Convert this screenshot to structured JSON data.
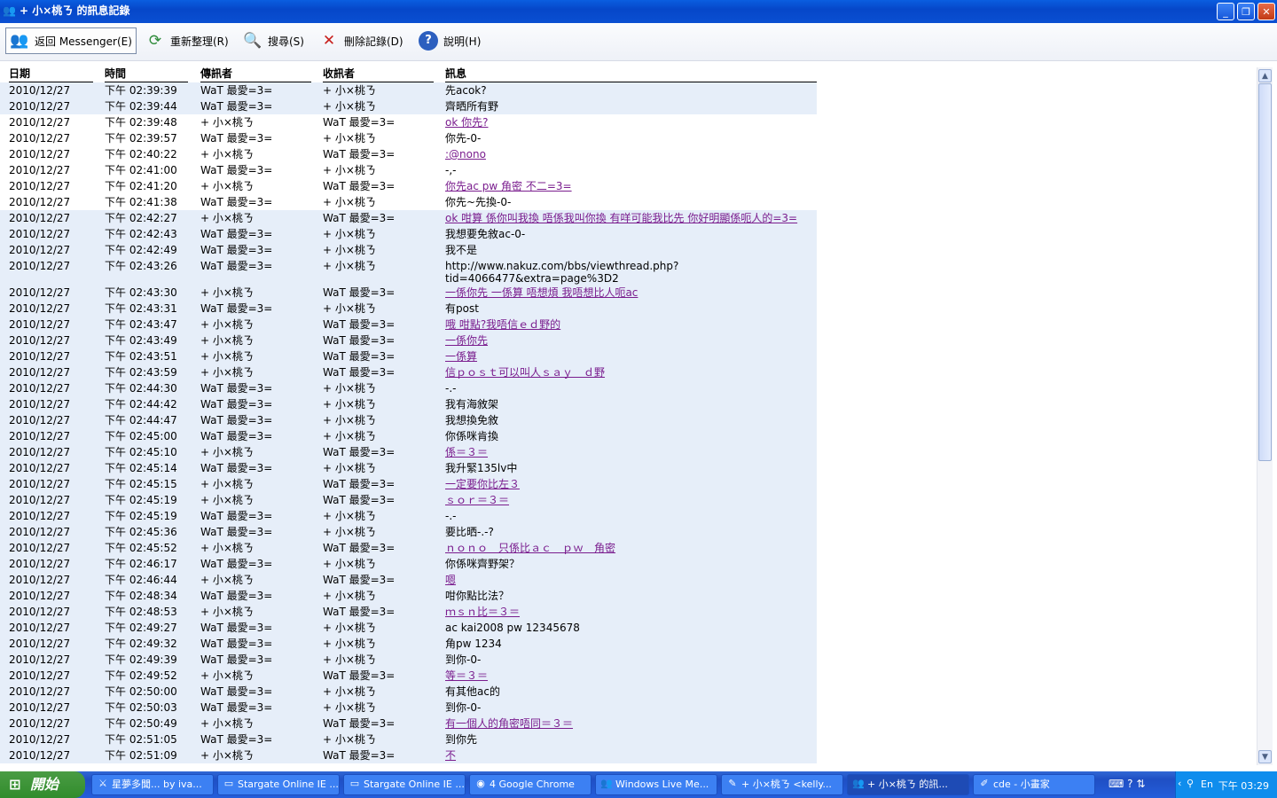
{
  "window": {
    "title": "+ 小×桃ㄋ 的訊息記錄",
    "icon": "messenger-people-icon",
    "minimize": "_",
    "restore": "❐",
    "close": "✕"
  },
  "toolbar": {
    "back_label": "返回 Messenger(E)",
    "refresh_label": "重新整理(R)",
    "search_label": "搜尋(S)",
    "delete_label": "刪除記錄(D)",
    "help_label": "說明(H)"
  },
  "table": {
    "headers": {
      "date": "日期",
      "time": "時間",
      "from": "傳訊者",
      "to": "收訊者",
      "msg": "訊息"
    },
    "rows": [
      {
        "date": "2010/12/27",
        "time": "下午 02:39:39",
        "from": "WaT 最愛=3=",
        "to": "+ 小×桃ㄋ",
        "msg": "先acok?",
        "link": false
      },
      {
        "date": "2010/12/27",
        "time": "下午 02:39:44",
        "from": "WaT 最愛=3=",
        "to": "+ 小×桃ㄋ",
        "msg": "齊晒所有野",
        "link": false
      },
      {
        "date": "2010/12/27",
        "time": "下午 02:39:48",
        "from": "+ 小×桃ㄋ",
        "to": "WaT 最愛=3=",
        "msg": "ok 你先?",
        "link": true
      },
      {
        "date": "2010/12/27",
        "time": "下午 02:39:57",
        "from": "WaT 最愛=3=",
        "to": "+ 小×桃ㄋ",
        "msg": "你先-0-",
        "link": false
      },
      {
        "date": "2010/12/27",
        "time": "下午 02:40:22",
        "from": "+ 小×桃ㄋ",
        "to": "WaT 最愛=3=",
        "msg": ":@nono",
        "link": true
      },
      {
        "date": "2010/12/27",
        "time": "下午 02:41:00",
        "from": "WaT 最愛=3=",
        "to": "+ 小×桃ㄋ",
        "msg": "-,-",
        "link": false
      },
      {
        "date": "2010/12/27",
        "time": "下午 02:41:20",
        "from": "+ 小×桃ㄋ",
        "to": "WaT 最愛=3=",
        "msg": "你先ac pw 角密 不二=3=",
        "link": true
      },
      {
        "date": "2010/12/27",
        "time": "下午 02:41:38",
        "from": "WaT 最愛=3=",
        "to": "+ 小×桃ㄋ",
        "msg": "你先~先換-0-",
        "link": false
      },
      {
        "date": "2010/12/27",
        "time": "下午 02:42:27",
        "from": "+ 小×桃ㄋ",
        "to": "WaT 最愛=3=",
        "msg": "ok 咁算 係你叫我換 唔係我叫你換 有咩可能我比先 你好明顯係呃人的=3=",
        "link": true
      },
      {
        "date": "2010/12/27",
        "time": "下午 02:42:43",
        "from": "WaT 最愛=3=",
        "to": "+ 小×桃ㄋ",
        "msg": "我想要免敘ac-0-",
        "link": false
      },
      {
        "date": "2010/12/27",
        "time": "下午 02:42:49",
        "from": "WaT 最愛=3=",
        "to": "+ 小×桃ㄋ",
        "msg": "我不是",
        "link": false
      },
      {
        "date": "2010/12/27",
        "time": "下午 02:43:26",
        "from": "WaT 最愛=3=",
        "to": "+ 小×桃ㄋ",
        "msg": "http://www.nakuz.com/bbs/viewthread.php?tid=4066477&extra=page%3D2",
        "link": false,
        "tall": true
      },
      {
        "date": "2010/12/27",
        "time": "下午 02:43:30",
        "from": "+ 小×桃ㄋ",
        "to": "WaT 最愛=3=",
        "msg": "一係你先 一係算 唔想煩 我唔想比人呃ac",
        "link": true
      },
      {
        "date": "2010/12/27",
        "time": "下午 02:43:31",
        "from": "WaT 最愛=3=",
        "to": "+ 小×桃ㄋ",
        "msg": "有post",
        "link": false
      },
      {
        "date": "2010/12/27",
        "time": "下午 02:43:47",
        "from": "+ 小×桃ㄋ",
        "to": "WaT 最愛=3=",
        "msg": "哦 咁點?我唔信ｅｄ野的",
        "link": true
      },
      {
        "date": "2010/12/27",
        "time": "下午 02:43:49",
        "from": "+ 小×桃ㄋ",
        "to": "WaT 最愛=3=",
        "msg": "一係你先",
        "link": true
      },
      {
        "date": "2010/12/27",
        "time": "下午 02:43:51",
        "from": "+ 小×桃ㄋ",
        "to": "WaT 最愛=3=",
        "msg": "一係算",
        "link": true
      },
      {
        "date": "2010/12/27",
        "time": "下午 02:43:59",
        "from": "+ 小×桃ㄋ",
        "to": "WaT 最愛=3=",
        "msg": "信ｐｏｓｔ可以叫人ｓａｙ　ｄ野",
        "link": true
      },
      {
        "date": "2010/12/27",
        "time": "下午 02:44:30",
        "from": "WaT 最愛=3=",
        "to": "+ 小×桃ㄋ",
        "msg": "-.-",
        "link": false
      },
      {
        "date": "2010/12/27",
        "time": "下午 02:44:42",
        "from": "WaT 最愛=3=",
        "to": "+ 小×桃ㄋ",
        "msg": "我有海敘架",
        "link": false
      },
      {
        "date": "2010/12/27",
        "time": "下午 02:44:47",
        "from": "WaT 最愛=3=",
        "to": "+ 小×桃ㄋ",
        "msg": "我想換免敘",
        "link": false
      },
      {
        "date": "2010/12/27",
        "time": "下午 02:45:00",
        "from": "WaT 最愛=3=",
        "to": "+ 小×桃ㄋ",
        "msg": "你係咪肯換",
        "link": false
      },
      {
        "date": "2010/12/27",
        "time": "下午 02:45:10",
        "from": "+ 小×桃ㄋ",
        "to": "WaT 最愛=3=",
        "msg": "係＝３＝",
        "link": true
      },
      {
        "date": "2010/12/27",
        "time": "下午 02:45:14",
        "from": "WaT 最愛=3=",
        "to": "+ 小×桃ㄋ",
        "msg": "我升緊135lv中",
        "link": false
      },
      {
        "date": "2010/12/27",
        "time": "下午 02:45:15",
        "from": "+ 小×桃ㄋ",
        "to": "WaT 最愛=3=",
        "msg": "一定要你比左３",
        "link": true
      },
      {
        "date": "2010/12/27",
        "time": "下午 02:45:19",
        "from": "+ 小×桃ㄋ",
        "to": "WaT 最愛=3=",
        "msg": "ｓｏｒ＝３＝",
        "link": true
      },
      {
        "date": "2010/12/27",
        "time": "下午 02:45:19",
        "from": "WaT 最愛=3=",
        "to": "+ 小×桃ㄋ",
        "msg": "-.-",
        "link": false
      },
      {
        "date": "2010/12/27",
        "time": "下午 02:45:36",
        "from": "WaT 最愛=3=",
        "to": "+ 小×桃ㄋ",
        "msg": "要比晒-.-?",
        "link": false
      },
      {
        "date": "2010/12/27",
        "time": "下午 02:45:52",
        "from": "+ 小×桃ㄋ",
        "to": "WaT 最愛=3=",
        "msg": "ｎｏｎｏ　只係比ａｃ　ｐｗ　角密",
        "link": true
      },
      {
        "date": "2010/12/27",
        "time": "下午 02:46:17",
        "from": "WaT 最愛=3=",
        "to": "+ 小×桃ㄋ",
        "msg": "你係咪齊野架？",
        "link": false
      },
      {
        "date": "2010/12/27",
        "time": "下午 02:46:44",
        "from": "+ 小×桃ㄋ",
        "to": "WaT 最愛=3=",
        "msg": "嗯",
        "link": true
      },
      {
        "date": "2010/12/27",
        "time": "下午 02:48:34",
        "from": "WaT 最愛=3=",
        "to": "+ 小×桃ㄋ",
        "msg": "咁你點比法？",
        "link": false
      },
      {
        "date": "2010/12/27",
        "time": "下午 02:48:53",
        "from": "+ 小×桃ㄋ",
        "to": "WaT 最愛=3=",
        "msg": "ｍｓｎ比＝３＝",
        "link": true
      },
      {
        "date": "2010/12/27",
        "time": "下午 02:49:27",
        "from": "WaT 最愛=3=",
        "to": "+ 小×桃ㄋ",
        "msg": "ac kai2008 pw 12345678",
        "link": false
      },
      {
        "date": "2010/12/27",
        "time": "下午 02:49:32",
        "from": "WaT 最愛=3=",
        "to": "+ 小×桃ㄋ",
        "msg": "角pw 1234",
        "link": false
      },
      {
        "date": "2010/12/27",
        "time": "下午 02:49:39",
        "from": "WaT 最愛=3=",
        "to": "+ 小×桃ㄋ",
        "msg": "到你-0-",
        "link": false
      },
      {
        "date": "2010/12/27",
        "time": "下午 02:49:52",
        "from": "+ 小×桃ㄋ",
        "to": "WaT 最愛=3=",
        "msg": "等＝３＝",
        "link": true
      },
      {
        "date": "2010/12/27",
        "time": "下午 02:50:00",
        "from": "WaT 最愛=3=",
        "to": "+ 小×桃ㄋ",
        "msg": "有其他ac的",
        "link": false
      },
      {
        "date": "2010/12/27",
        "time": "下午 02:50:03",
        "from": "WaT 最愛=3=",
        "to": "+ 小×桃ㄋ",
        "msg": "到你-0-",
        "link": false
      },
      {
        "date": "2010/12/27",
        "time": "下午 02:50:49",
        "from": "+ 小×桃ㄋ",
        "to": "WaT 最愛=3=",
        "msg": "有一個人的角密唔同＝３＝",
        "link": true
      },
      {
        "date": "2010/12/27",
        "time": "下午 02:51:05",
        "from": "WaT 最愛=3=",
        "to": "+ 小×桃ㄋ",
        "msg": "到你先",
        "link": false
      },
      {
        "date": "2010/12/27",
        "time": "下午 02:51:09",
        "from": "+ 小×桃ㄋ",
        "to": "WaT 最愛=3=",
        "msg": "不",
        "link": true
      }
    ]
  },
  "scrollbar": {
    "up": "▲",
    "down": "▼"
  },
  "taskbar": {
    "start_label": "開始",
    "tasks": [
      {
        "label": "星夢多聞... by iva...",
        "icon": "game-icon"
      },
      {
        "label": "Stargate Online IE ...",
        "icon": "window-icon"
      },
      {
        "label": "Stargate Online IE ...",
        "icon": "window-icon"
      },
      {
        "label": "4 Google Chrome",
        "icon": "chrome-icon"
      },
      {
        "label": "Windows Live Me...",
        "icon": "messenger-icon"
      },
      {
        "label": "+ 小×桃ㄋ <kelly...",
        "icon": "chat-icon"
      },
      {
        "label": "+ 小×桃ㄋ 的訊...",
        "icon": "messenger-icon"
      },
      {
        "label": "cde - 小畫家",
        "icon": "paint-icon"
      }
    ],
    "lang": "En",
    "clock": "下午 03:29"
  }
}
